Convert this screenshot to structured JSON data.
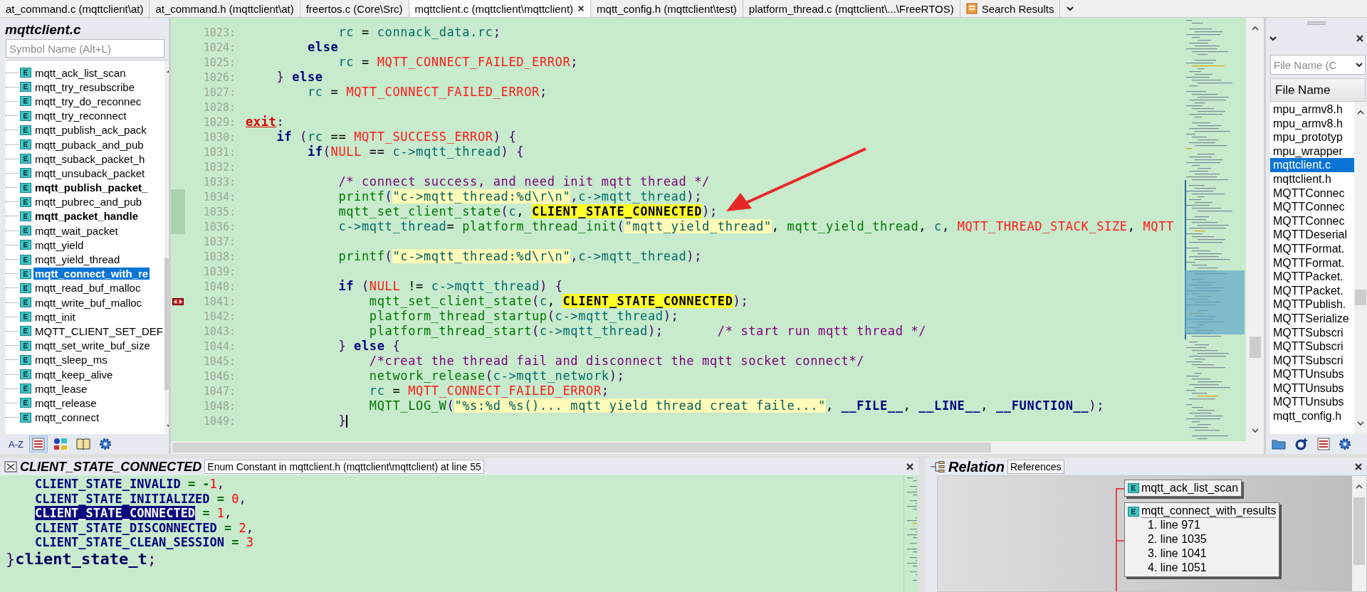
{
  "tabs": [
    {
      "label": "at_command.c (mqttclient\\at)",
      "kind": "file",
      "selected": false
    },
    {
      "label": "at_command.h (mqttclient\\at)",
      "kind": "file",
      "selected": false
    },
    {
      "label": "freertos.c (Core\\Src)",
      "kind": "file",
      "selected": false
    },
    {
      "label": "mqttclient.c (mqttclient\\mqttclient)",
      "kind": "file",
      "selected": true
    },
    {
      "label": "mqtt_config.h (mqttclient\\test)",
      "kind": "file",
      "selected": false
    },
    {
      "label": "platform_thread.c (mqttclient\\...\\FreeRTOS)",
      "kind": "file",
      "selected": false
    },
    {
      "label": "Search Results",
      "kind": "search",
      "selected": false
    }
  ],
  "symbol_panel": {
    "title": "mqttclient.c",
    "search": {
      "placeholder": "Symbol Name (Alt+L)"
    },
    "items": [
      {
        "name": "mqtt_ack_list_scan",
        "bold": false,
        "selected": false
      },
      {
        "name": "mqtt_try_resubscribe",
        "bold": false,
        "selected": false
      },
      {
        "name": "mqtt_try_do_reconnec",
        "bold": false,
        "selected": false
      },
      {
        "name": "mqtt_try_reconnect",
        "bold": false,
        "selected": false
      },
      {
        "name": "mqtt_publish_ack_pack",
        "bold": false,
        "selected": false
      },
      {
        "name": "mqtt_puback_and_pub",
        "bold": false,
        "selected": false
      },
      {
        "name": "mqtt_suback_packet_h",
        "bold": false,
        "selected": false
      },
      {
        "name": "mqtt_unsuback_packet",
        "bold": false,
        "selected": false
      },
      {
        "name": "mqtt_publish_packet_",
        "bold": true,
        "selected": false
      },
      {
        "name": "mqtt_pubrec_and_pub",
        "bold": false,
        "selected": false
      },
      {
        "name": "mqtt_packet_handle",
        "bold": true,
        "selected": false
      },
      {
        "name": "mqtt_wait_packet",
        "bold": false,
        "selected": false
      },
      {
        "name": "mqtt_yield",
        "bold": false,
        "selected": false
      },
      {
        "name": "mqtt_yield_thread",
        "bold": false,
        "selected": false
      },
      {
        "name": "mqtt_connect_with_re",
        "bold": false,
        "selected": true
      },
      {
        "name": "mqtt_read_buf_malloc",
        "bold": false,
        "selected": false
      },
      {
        "name": "mqtt_write_buf_malloc",
        "bold": false,
        "selected": false
      },
      {
        "name": "mqtt_init",
        "bold": false,
        "selected": false
      },
      {
        "name": "MQTT_CLIENT_SET_DEF",
        "bold": false,
        "selected": false
      },
      {
        "name": "mqtt_set_write_buf_size",
        "bold": false,
        "selected": false
      },
      {
        "name": "mqtt_sleep_ms",
        "bold": false,
        "selected": false
      },
      {
        "name": "mqtt_keep_alive",
        "bold": false,
        "selected": false
      },
      {
        "name": "mqtt_lease",
        "bold": false,
        "selected": false
      },
      {
        "name": "mqtt_release",
        "bold": false,
        "selected": false
      },
      {
        "name": "mqtt_connect",
        "bold": false,
        "selected": false
      }
    ],
    "toolbar": [
      {
        "kind": "sort",
        "label": "A-Z",
        "selected": false
      },
      {
        "kind": "list",
        "selected": true
      },
      {
        "kind": "categories",
        "selected": false
      },
      {
        "kind": "book",
        "selected": false
      },
      {
        "kind": "settings",
        "selected": false
      }
    ]
  },
  "editor": {
    "lines": [
      {
        "number": "1023:",
        "changed": false,
        "bookmark": false,
        "tokens": [
          {
            "kind": "var",
            "text": "            rc"
          },
          {
            "kind": "plain",
            "text": " = "
          },
          {
            "kind": "var",
            "text": "connack_data.rc"
          },
          {
            "kind": "punct",
            "text": ";"
          }
        ]
      },
      {
        "number": "1024:",
        "changed": false,
        "bookmark": false,
        "tokens": [
          {
            "kind": "kw",
            "text": "        else"
          }
        ]
      },
      {
        "number": "1025:",
        "changed": false,
        "bookmark": false,
        "tokens": [
          {
            "kind": "var",
            "text": "            rc"
          },
          {
            "kind": "plain",
            "text": " = "
          },
          {
            "kind": "const",
            "text": "MQTT_CONNECT_FAILED_ERROR"
          },
          {
            "kind": "punct",
            "text": ";"
          }
        ]
      },
      {
        "number": "1026:",
        "changed": false,
        "bookmark": false,
        "tokens": [
          {
            "kind": "punct",
            "text": "    } "
          },
          {
            "kind": "kw",
            "text": "else"
          }
        ]
      },
      {
        "number": "1027:",
        "changed": false,
        "bookmark": false,
        "tokens": [
          {
            "kind": "var",
            "text": "        rc"
          },
          {
            "kind": "plain",
            "text": " = "
          },
          {
            "kind": "const",
            "text": "MQTT_CONNECT_FAILED_ERROR"
          },
          {
            "kind": "punct",
            "text": ";"
          }
        ]
      },
      {
        "number": "1028:",
        "changed": false,
        "bookmark": false
      },
      {
        "number": "1029:",
        "changed": false,
        "bookmark": false,
        "tokens": [
          {
            "kind": "label",
            "text": "exit"
          },
          {
            "kind": "punct",
            "text": ":"
          }
        ]
      },
      {
        "number": "1030:",
        "changed": false,
        "bookmark": false,
        "tokens": [
          {
            "kind": "kw",
            "text": "    if "
          },
          {
            "kind": "punct",
            "text": "("
          },
          {
            "kind": "var",
            "text": "rc"
          },
          {
            "kind": "plain",
            "text": " == "
          },
          {
            "kind": "const",
            "text": "MQTT_SUCCESS_ERROR"
          },
          {
            "kind": "punct",
            "text": ") {"
          }
        ]
      },
      {
        "number": "1031:",
        "changed": false,
        "bookmark": false,
        "tokens": [
          {
            "kind": "kw",
            "text": "        if"
          },
          {
            "kind": "punct",
            "text": "("
          },
          {
            "kind": "const",
            "text": "NULL"
          },
          {
            "kind": "plain",
            "text": " == "
          },
          {
            "kind": "var",
            "text": "c->mqtt_thread"
          },
          {
            "kind": "punct",
            "text": ") {"
          }
        ]
      },
      {
        "number": "1032:",
        "changed": false,
        "bookmark": false
      },
      {
        "number": "1033:",
        "changed": false,
        "bookmark": false,
        "tokens": [
          {
            "kind": "comment",
            "text": "            /* connect success, and need init mqtt thread */"
          }
        ]
      },
      {
        "number": "1034:",
        "changed": true,
        "bookmark": false,
        "tokens": [
          {
            "kind": "func",
            "text": "            printf"
          },
          {
            "kind": "punct",
            "text": "("
          },
          {
            "kind": "str",
            "text": "\"c->mqtt_thread:%d\\r\\n\""
          },
          {
            "kind": "punct",
            "text": ","
          },
          {
            "kind": "var",
            "text": "c->mqtt_thread"
          },
          {
            "kind": "punct",
            "text": ");"
          }
        ]
      },
      {
        "number": "1035:",
        "changed": true,
        "bookmark": false,
        "tokens": [
          {
            "kind": "func",
            "text": "            mqtt_set_client_state"
          },
          {
            "kind": "punct",
            "text": "("
          },
          {
            "kind": "var",
            "text": "c"
          },
          {
            "kind": "plain",
            "text": ", "
          },
          {
            "kind": "hl",
            "text": "CLIENT_STATE_CONNECTED"
          },
          {
            "kind": "punct",
            "text": ");"
          }
        ]
      },
      {
        "number": "1036:",
        "changed": true,
        "bookmark": false,
        "tokens": [
          {
            "kind": "var",
            "text": "            c->mqtt_thread"
          },
          {
            "kind": "plain",
            "text": "= "
          },
          {
            "kind": "func",
            "text": "platform_thread_init"
          },
          {
            "kind": "punct",
            "text": "("
          },
          {
            "kind": "str",
            "text": "\"mqtt_yield_thread\""
          },
          {
            "kind": "plain",
            "text": ", "
          },
          {
            "kind": "func",
            "text": "mqtt_yield_thread"
          },
          {
            "kind": "plain",
            "text": ", "
          },
          {
            "kind": "var",
            "text": "c"
          },
          {
            "kind": "plain",
            "text": ", "
          },
          {
            "kind": "const",
            "text": "MQTT_THREAD_STACK_SIZE"
          },
          {
            "kind": "plain",
            "text": ", "
          },
          {
            "kind": "const",
            "text": "MQTT"
          }
        ]
      },
      {
        "number": "1037:",
        "changed": false,
        "bookmark": false
      },
      {
        "number": "1038:",
        "changed": false,
        "bookmark": false,
        "tokens": [
          {
            "kind": "func",
            "text": "            printf"
          },
          {
            "kind": "punct",
            "text": "("
          },
          {
            "kind": "str",
            "text": "\"c->mqtt_thread:%d\\r\\n\""
          },
          {
            "kind": "punct",
            "text": ","
          },
          {
            "kind": "var",
            "text": "c->mqtt_thread"
          },
          {
            "kind": "punct",
            "text": ");"
          }
        ]
      },
      {
        "number": "1039:",
        "changed": false,
        "bookmark": false
      },
      {
        "number": "1040:",
        "changed": false,
        "bookmark": false,
        "tokens": [
          {
            "kind": "kw",
            "text": "            if "
          },
          {
            "kind": "punct",
            "text": "("
          },
          {
            "kind": "const",
            "text": "NULL"
          },
          {
            "kind": "plain",
            "text": " != "
          },
          {
            "kind": "var",
            "text": "c->mqtt_thread"
          },
          {
            "kind": "punct",
            "text": ") {"
          }
        ]
      },
      {
        "number": "1041:",
        "changed": false,
        "bookmark": true,
        "tokens": [
          {
            "kind": "func",
            "text": "                mqtt_set_client_state"
          },
          {
            "kind": "punct",
            "text": "("
          },
          {
            "kind": "var",
            "text": "c"
          },
          {
            "kind": "plain",
            "text": ", "
          },
          {
            "kind": "hl",
            "text": "CLIENT_STATE_CONNECTED"
          },
          {
            "kind": "punct",
            "text": ");"
          }
        ]
      },
      {
        "number": "1042:",
        "changed": false,
        "bookmark": false,
        "tokens": [
          {
            "kind": "func",
            "text": "                platform_thread_startup"
          },
          {
            "kind": "punct",
            "text": "("
          },
          {
            "kind": "var",
            "text": "c->mqtt_thread"
          },
          {
            "kind": "punct",
            "text": ");"
          }
        ]
      },
      {
        "number": "1043:",
        "changed": false,
        "bookmark": false,
        "tokens": [
          {
            "kind": "func",
            "text": "                platform_thread_start"
          },
          {
            "kind": "punct",
            "text": "("
          },
          {
            "kind": "var",
            "text": "c->mqtt_thread"
          },
          {
            "kind": "punct",
            "text": ");       "
          },
          {
            "kind": "comment",
            "text": "/* start run mqtt thread */"
          }
        ]
      },
      {
        "number": "1044:",
        "changed": false,
        "bookmark": false,
        "tokens": [
          {
            "kind": "punct",
            "text": "            } "
          },
          {
            "kind": "kw",
            "text": "else "
          },
          {
            "kind": "punct",
            "text": "{"
          }
        ]
      },
      {
        "number": "1045:",
        "changed": false,
        "bookmark": false,
        "tokens": [
          {
            "kind": "comment",
            "text": "                /*creat the thread fail and disconnect the mqtt socket connect*/"
          }
        ]
      },
      {
        "number": "1046:",
        "changed": false,
        "bookmark": false,
        "tokens": [
          {
            "kind": "func",
            "text": "                network_release"
          },
          {
            "kind": "punct",
            "text": "("
          },
          {
            "kind": "var",
            "text": "c->mqtt_network"
          },
          {
            "kind": "punct",
            "text": ");"
          }
        ]
      },
      {
        "number": "1047:",
        "changed": false,
        "bookmark": false,
        "tokens": [
          {
            "kind": "var",
            "text": "                rc"
          },
          {
            "kind": "plain",
            "text": " = "
          },
          {
            "kind": "const",
            "text": "MQTT_CONNECT_FAILED_ERROR"
          },
          {
            "kind": "punct",
            "text": ";"
          }
        ]
      },
      {
        "number": "1048:",
        "changed": false,
        "bookmark": false,
        "tokens": [
          {
            "kind": "func",
            "text": "                MQTT_LOG_W"
          },
          {
            "kind": "punct",
            "text": "("
          },
          {
            "kind": "str",
            "text": "\"%s:%d %s()... mqtt yield thread creat faile...\""
          },
          {
            "kind": "plain",
            "text": ", "
          },
          {
            "kind": "kw",
            "text": "__FILE__"
          },
          {
            "kind": "plain",
            "text": ", "
          },
          {
            "kind": "kw",
            "text": "__LINE__"
          },
          {
            "kind": "plain",
            "text": ", "
          },
          {
            "kind": "kw",
            "text": "__FUNCTION__"
          },
          {
            "kind": "punct",
            "text": ");"
          }
        ]
      },
      {
        "number": "1049:",
        "changed": false,
        "bookmark": false,
        "cursor": true,
        "tokens": [
          {
            "kind": "punct",
            "text": "            }"
          }
        ]
      }
    ]
  },
  "file_panel": {
    "search": {
      "placeholder": "File Name (C"
    },
    "column": "File Name",
    "files": [
      {
        "name": "mpu_armv8.h",
        "selected": false
      },
      {
        "name": "mpu_armv8.h",
        "selected": false
      },
      {
        "name": "mpu_prototyp",
        "selected": false
      },
      {
        "name": "mpu_wrapper",
        "selected": false
      },
      {
        "name": "mqttclient.c",
        "selected": true
      },
      {
        "name": "mqttclient.h",
        "selected": false
      },
      {
        "name": "MQTTConnec",
        "selected": false
      },
      {
        "name": "MQTTConnec",
        "selected": false
      },
      {
        "name": "MQTTConnec",
        "selected": false
      },
      {
        "name": "MQTTDeserial",
        "selected": false
      },
      {
        "name": "MQTTFormat.",
        "selected": false
      },
      {
        "name": "MQTTFormat.",
        "selected": false
      },
      {
        "name": "MQTTPacket.",
        "selected": false
      },
      {
        "name": "MQTTPacket.",
        "selected": false
      },
      {
        "name": "MQTTPublish.",
        "selected": false
      },
      {
        "name": "MQTTSerialize",
        "selected": false
      },
      {
        "name": "MQTTSubscri",
        "selected": false
      },
      {
        "name": "MQTTSubscri",
        "selected": false
      },
      {
        "name": "MQTTSubscri",
        "selected": false
      },
      {
        "name": "MQTTUnsubs",
        "selected": false
      },
      {
        "name": "MQTTUnsubs",
        "selected": false
      },
      {
        "name": "MQTTUnsubs",
        "selected": false
      },
      {
        "name": "mqtt_config.h",
        "selected": false
      }
    ],
    "toolbar": [
      {
        "kind": "project"
      },
      {
        "kind": "add"
      },
      {
        "kind": "list"
      },
      {
        "kind": "settings"
      }
    ]
  },
  "context_panel": {
    "symbol": "CLIENT_STATE_CONNECTED",
    "info": "Enum Constant in mqttclient.h (mqttclient\\mqttclient) at line 55",
    "lines": [
      {
        "kind": "member",
        "tokens": [
          {
            "kind": "enum",
            "text": "CLIENT_STATE_INVALID"
          },
          {
            "kind": "op",
            "text": " = -"
          },
          {
            "kind": "num",
            "text": "1"
          },
          {
            "kind": "punct",
            "text": ","
          }
        ]
      },
      {
        "kind": "member",
        "tokens": [
          {
            "kind": "enum",
            "text": "CLIENT_STATE_INITIALIZED"
          },
          {
            "kind": "op",
            "text": " = "
          },
          {
            "kind": "num",
            "text": "0"
          },
          {
            "kind": "punct",
            "text": ","
          }
        ]
      },
      {
        "kind": "member",
        "tokens": [
          {
            "kind": "sel",
            "text": "CLIENT_STATE_CONNECTED"
          },
          {
            "kind": "op",
            "text": " = "
          },
          {
            "kind": "num",
            "text": "1"
          },
          {
            "kind": "punct",
            "text": ","
          }
        ]
      },
      {
        "kind": "member",
        "tokens": [
          {
            "kind": "enum",
            "text": "CLIENT_STATE_DISCONNECTED"
          },
          {
            "kind": "op",
            "text": " = "
          },
          {
            "kind": "num",
            "text": "2"
          },
          {
            "kind": "punct",
            "text": ","
          }
        ]
      },
      {
        "kind": "member",
        "tokens": [
          {
            "kind": "enum",
            "text": "CLIENT_STATE_CLEAN_SESSION"
          },
          {
            "kind": "op",
            "text": " = "
          },
          {
            "kind": "num",
            "text": "3"
          }
        ]
      },
      {
        "kind": "close",
        "tokens": [
          {
            "kind": "punct",
            "text": "}"
          },
          {
            "kind": "type",
            "text": "client_state_t"
          },
          {
            "kind": "punct",
            "text": ";"
          }
        ]
      }
    ]
  },
  "relation_panel": {
    "title": "Relation",
    "mode": "References",
    "nodes": [
      {
        "name": "mqtt_ack_list_scan"
      },
      {
        "name": "mqtt_connect_with_results",
        "refs": [
          "1. line 971",
          "2. line 1035",
          "3. line 1041",
          "4. line 1051"
        ]
      }
    ]
  }
}
